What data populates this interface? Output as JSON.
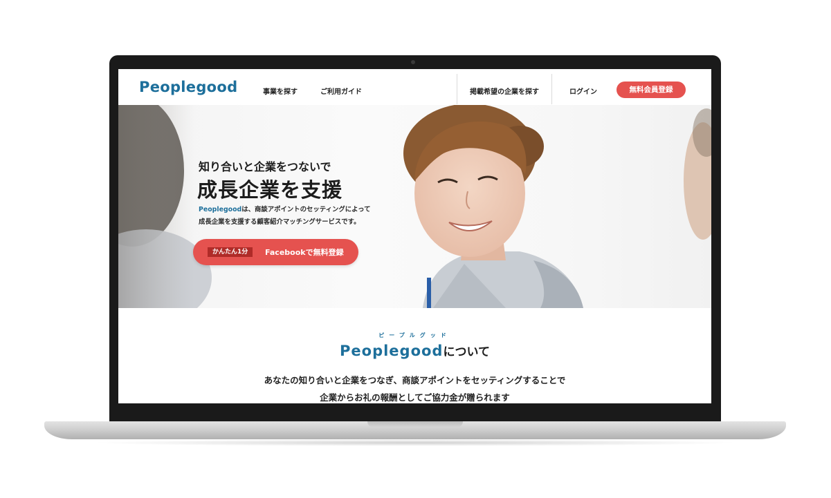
{
  "header": {
    "logo": "Peoplegood",
    "nav": {
      "find_business": "事業を探す",
      "guide": "ご利用ガイド",
      "find_company": "掲載希望の企業を探す",
      "login": "ログイン"
    },
    "signup_button": "無料会員登録"
  },
  "hero": {
    "kicker": "知り合いと企業をつないで",
    "title": "成長企業を支援",
    "description": {
      "brand": "Peoplegood",
      "line1_rest": "は、商談アポイントのセッティングによって",
      "line2": "成長企業を支援する顧客紹介マッチングサービスです。"
    },
    "cta": {
      "badge": "かんたん1分",
      "label": "Facebookで無料登録"
    }
  },
  "about": {
    "ruby": "ピープルグッド",
    "title_brand": "Peoplegood",
    "title_rest": "について",
    "line1": "あなたの知り合いと企業をつなぎ、商談アポイントをセッティングすることで",
    "line2": "企業からお礼の報酬としてご協力金が贈られます"
  },
  "colors": {
    "brand_blue": "#1d6f9b",
    "accent_red": "#e5524f",
    "badge_red": "#b02b28"
  }
}
